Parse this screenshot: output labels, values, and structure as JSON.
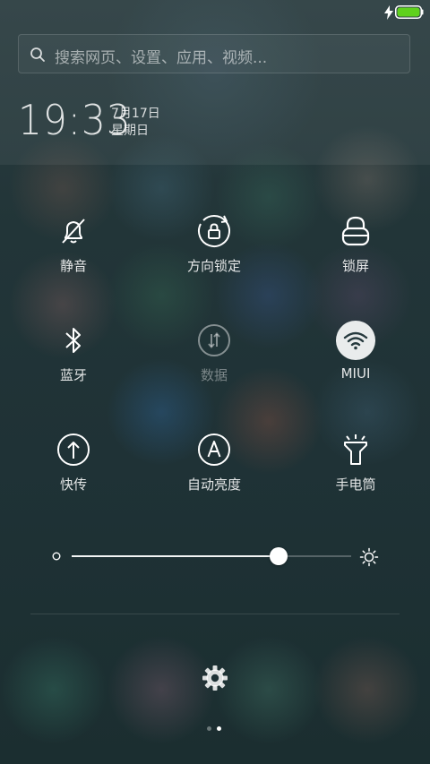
{
  "search": {
    "placeholder": "搜索网页、设置、应用、视频..."
  },
  "clock": {
    "time": "19:33",
    "date": "7月17日",
    "weekday": "星期日"
  },
  "toggles": [
    {
      "label": "静音",
      "icon": "bell-off-icon",
      "state": "off"
    },
    {
      "label": "方向锁定",
      "icon": "rotation-lock-icon",
      "state": "off"
    },
    {
      "label": "锁屏",
      "icon": "lock-icon",
      "state": "off"
    },
    {
      "label": "蓝牙",
      "icon": "bluetooth-icon",
      "state": "off"
    },
    {
      "label": "数据",
      "icon": "mobile-data-icon",
      "state": "disabled"
    },
    {
      "label": "MIUI",
      "icon": "wifi-icon",
      "state": "on"
    },
    {
      "label": "快传",
      "icon": "share-upload-icon",
      "state": "off"
    },
    {
      "label": "自动亮度",
      "icon": "auto-brightness-icon",
      "state": "off"
    },
    {
      "label": "手电筒",
      "icon": "flashlight-icon",
      "state": "off"
    }
  ],
  "brightness": {
    "level": 0.74
  },
  "pager": {
    "current_page": 2,
    "total_pages": 2
  },
  "colors": {
    "battery": "#5fd11d",
    "active_toggle_bg": "#e9ecec"
  }
}
